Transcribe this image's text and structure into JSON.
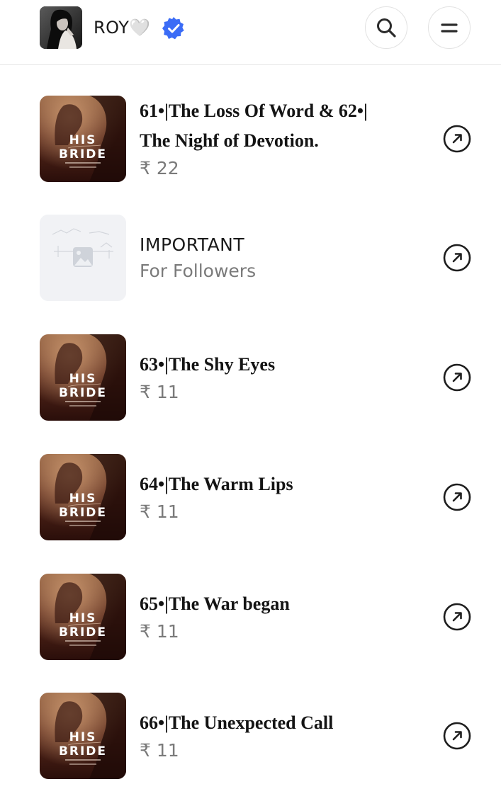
{
  "header": {
    "creator_name": "ROY🤍",
    "verified_icon": "verified-badge-icon",
    "search_icon": "search-icon",
    "menu_icon": "menu-icon"
  },
  "items": [
    {
      "title_line1": "61•|The Loss Of Word & 62•|",
      "title_line2": "The Nighf of Devotion.",
      "price": "₹ 22",
      "thumbnail": "his-bride-cover",
      "cover_text_top": "HIS",
      "cover_text_bottom": "BRIDE"
    },
    {
      "title_line1": "IMPORTANT",
      "subtitle": "For Followers",
      "thumbnail": "image-placeholder-icon"
    },
    {
      "title_line1": "63•|The Shy Eyes",
      "price": "₹ 11",
      "thumbnail": "his-bride-cover",
      "cover_text_top": "HIS",
      "cover_text_bottom": "BRIDE"
    },
    {
      "title_line1": "64•|The Warm Lips",
      "price": "₹ 11",
      "thumbnail": "his-bride-cover",
      "cover_text_top": "HIS",
      "cover_text_bottom": "BRIDE"
    },
    {
      "title_line1": "65•|The War began",
      "price": "₹ 11",
      "thumbnail": "his-bride-cover",
      "cover_text_top": "HIS",
      "cover_text_bottom": "BRIDE"
    },
    {
      "title_line1": "66•|The Unexpected Call",
      "price": "₹ 11",
      "thumbnail": "his-bride-cover",
      "cover_text_top": "HIS",
      "cover_text_bottom": "BRIDE"
    }
  ],
  "colors": {
    "verified": "#3b6cf6",
    "price_gray": "#7a7a7a",
    "divider": "#e6e6e6"
  }
}
